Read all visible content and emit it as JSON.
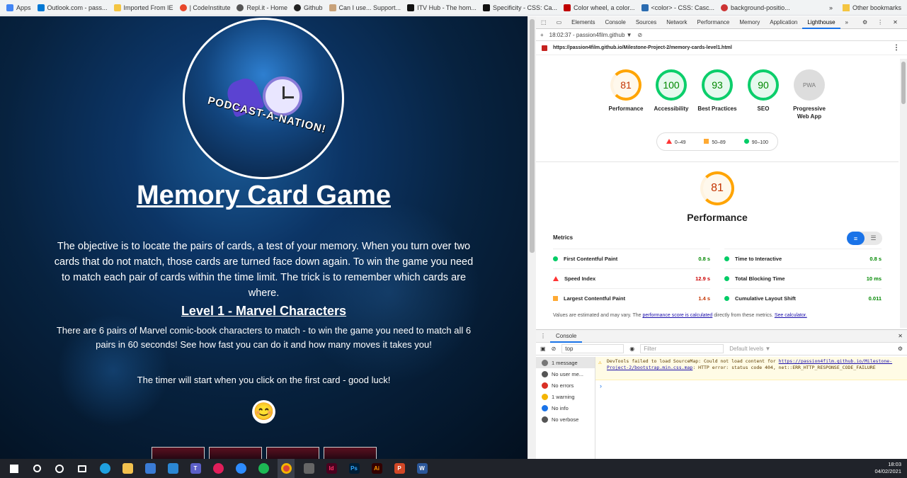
{
  "bookmarks": {
    "items": [
      {
        "label": "Apps",
        "color": "#4285f4"
      },
      {
        "label": "Outlook.com - pass...",
        "color": "#0078d4"
      },
      {
        "label": "Imported From IE",
        "color": "#f4c542"
      },
      {
        "label": "| CodeInstitute",
        "color": "#e8472b"
      },
      {
        "label": "Repl.it - Home",
        "color": "#555555"
      },
      {
        "label": "Github",
        "color": "#222222"
      },
      {
        "label": "Can I use... Support...",
        "color": "#c8a27a"
      },
      {
        "label": "ITV Hub - The hom...",
        "color": "#111111"
      },
      {
        "label": "Specificity - CSS: Ca...",
        "color": "#111111"
      },
      {
        "label": "Color wheel, a color...",
        "color": "#c00000"
      },
      {
        "label": "<color> - CSS: Casc...",
        "color": "#2b6cb0"
      },
      {
        "label": "background-positio...",
        "color": "#cc3333"
      }
    ],
    "more": "»",
    "other": "Other bookmarks"
  },
  "page": {
    "logo_text": "PODCAST-A-NATION!",
    "title": "Memory Card Game",
    "intro": "The objective is to locate the pairs of cards, a test of your memory. When you turn over two cards that do not match, those cards are turned face down again. To win the game you need to match each pair of cards within the time limit. The trick is to remember which cards are where.",
    "level_title": "Level 1 - Marvel Characters",
    "level_desc": "There are 6 pairs of Marvel comic-book characters to match - to win the game you need to match all 6 pairs in 60 seconds! See how fast you can do it and how many moves it takes you!",
    "timer_text": "The timer will start when you click on the first card - good luck!",
    "smiley": "😊"
  },
  "devtools": {
    "tabs": [
      "Elements",
      "Console",
      "Sources",
      "Network",
      "Performance",
      "Memory",
      "Application",
      "Lighthouse"
    ],
    "active_tab": "Lighthouse",
    "report_time": "18:02:37 - passion4film.github ▼",
    "url": "https://passion4film.github.io/Milestone-Project-2/memory-cards-level1.html",
    "scores": [
      {
        "label": "Performance",
        "value": "81",
        "level": "orange"
      },
      {
        "label": "Accessibility",
        "value": "100",
        "level": "green"
      },
      {
        "label": "Best Practices",
        "value": "93",
        "level": "green"
      },
      {
        "label": "SEO",
        "value": "90",
        "level": "green"
      },
      {
        "label": "Progressive Web App",
        "value": "PWA",
        "level": "pwa"
      }
    ],
    "legend": [
      "0–49",
      "50–89",
      "90–100"
    ],
    "perf_score": "81",
    "perf_title": "Performance",
    "metrics_label": "Metrics",
    "metrics": [
      {
        "label": "First Contentful Paint",
        "value": "0.8 s",
        "status": "good"
      },
      {
        "label": "Time to Interactive",
        "value": "0.8 s",
        "status": "good"
      },
      {
        "label": "Speed Index",
        "value": "12.9 s",
        "status": "poor"
      },
      {
        "label": "Total Blocking Time",
        "value": "10 ms",
        "status": "good"
      },
      {
        "label": "Largest Contentful Paint",
        "value": "1.4 s",
        "status": "average"
      },
      {
        "label": "Cumulative Layout Shift",
        "value": "0.011",
        "status": "good"
      }
    ],
    "note_text": "Values are estimated and may vary. The ",
    "note_link1": "performance score is calculated",
    "note_mid": " directly from these metrics. ",
    "note_link2": "See calculator."
  },
  "console": {
    "tab": "Console",
    "context": "top",
    "filter_placeholder": "Filter",
    "levels": "Default levels ▼",
    "sidebar": [
      {
        "label": "1 message",
        "color": "#777777"
      },
      {
        "label": "No user me...",
        "color": "#555555"
      },
      {
        "label": "No errors",
        "color": "#d93025"
      },
      {
        "label": "1 warning",
        "color": "#f4b400"
      },
      {
        "label": "No info",
        "color": "#1a73e8"
      },
      {
        "label": "No verbose",
        "color": "#555555"
      }
    ],
    "message_text": "DevTools failed to load SourceMap: Could not load content for ",
    "message_link": "https://passion4film.github.io/Milestone-Project-2/bootstrap.min.css.map",
    "message_tail": ": HTTP error: status code 404, net::ERR_HTTP_RESPONSE_CODE_FAILURE"
  },
  "taskbar": {
    "time": "18:03",
    "date": "04/02/2021"
  }
}
